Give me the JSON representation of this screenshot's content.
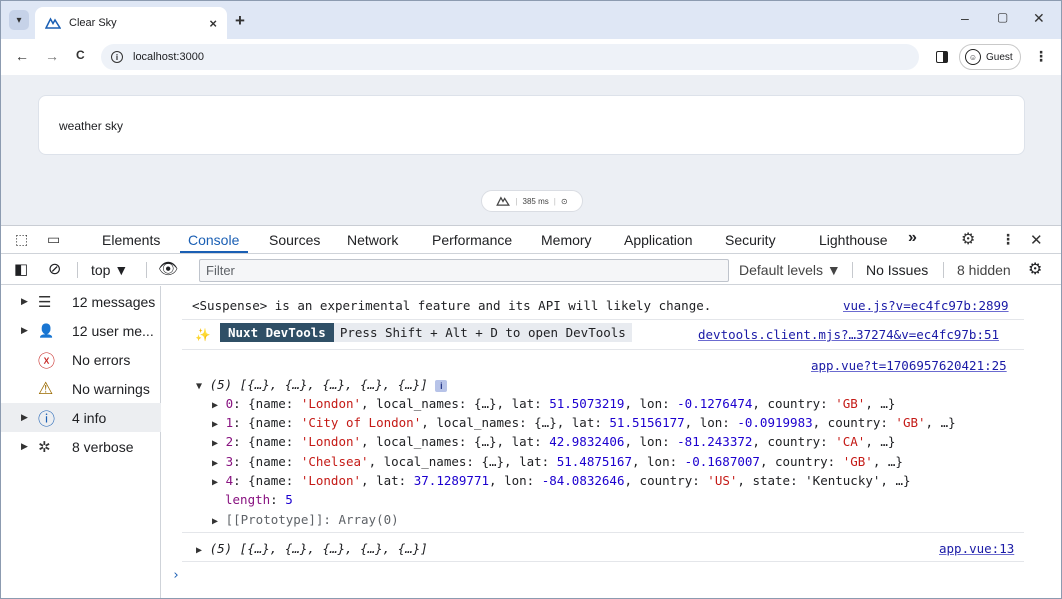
{
  "browser": {
    "tab": {
      "title": "Clear Sky",
      "close": "×"
    },
    "new_tab": "+",
    "window_controls": {
      "minimize": "–",
      "maximize": "▢",
      "close": "✕"
    },
    "nav": {
      "back": "←",
      "forward": "→",
      "reload": "C"
    },
    "url": "localhost:3000",
    "guest_label": "Guest",
    "menu": "⋮"
  },
  "page": {
    "card_text": "weather sky",
    "nuxt_pill": {
      "time": "385 ms"
    }
  },
  "devtools": {
    "tabs": [
      "Elements",
      "Console",
      "Sources",
      "Network",
      "Performance",
      "Memory",
      "Application",
      "Security",
      "Lighthouse"
    ],
    "active_tab": "Console",
    "more_tabs": "»",
    "console_bar": {
      "context": "top ▼",
      "filter_placeholder": "Filter",
      "levels": "Default levels ▼",
      "issues": "No Issues",
      "hidden": "8 hidden"
    },
    "sidebar": [
      {
        "label": "12 messages",
        "icon": "list-icon",
        "glyph": "☰",
        "arrow": "▶"
      },
      {
        "label": "12 user me...",
        "icon": "user-icon",
        "glyph": "👤",
        "arrow": "▶"
      },
      {
        "label": "No errors",
        "icon": "error-icon",
        "glyph": "ⓧ",
        "arrow": ""
      },
      {
        "label": "No warnings",
        "icon": "warning-icon",
        "glyph": "⚠",
        "arrow": ""
      },
      {
        "label": "4 info",
        "icon": "info-icon",
        "glyph": "ⓘ",
        "arrow": "▶"
      },
      {
        "label": "8 verbose",
        "icon": "bug-icon",
        "glyph": "✲",
        "arrow": "▶"
      }
    ],
    "log": {
      "suspense": {
        "text": "<Suspense> is an experimental feature and its API will likely change.",
        "source": "vue.js?v=ec4fc97b:2899"
      },
      "nuxt": {
        "badge": "Nuxt DevTools",
        "message": "Press Shift + Alt + D to open DevTools",
        "source": "devtools.client.mjs?…37274&v=ec4fc97b:51"
      },
      "array_source": "app.vue?t=1706957620421:25",
      "array_header": "(5) [{…}, {…}, {…}, {…}, {…}]",
      "items": [
        {
          "idx": "0",
          "name": "'London'",
          "mid": "local_names: {…}, lat: ",
          "lat": "51.5073219",
          "lon": "-0.1276474",
          "country": "'GB'",
          "tail": ", …}"
        },
        {
          "idx": "1",
          "name": "'City of London'",
          "mid": "local_names: {…}, lat: ",
          "lat": "51.5156177",
          "lon": "-0.0919983",
          "country": "'GB'",
          "tail": ", …}"
        },
        {
          "idx": "2",
          "name": "'London'",
          "mid": "local_names: {…}, lat: ",
          "lat": "42.9832406",
          "lon": "-81.243372",
          "country": "'CA'",
          "tail": ", …}"
        },
        {
          "idx": "3",
          "name": "'Chelsea'",
          "mid": "local_names: {…}, lat: ",
          "lat": "51.4875167",
          "lon": "-0.1687007",
          "country": "'GB'",
          "tail": ", …}"
        },
        {
          "idx": "4",
          "name": "'London'",
          "mid": "lat: ",
          "lat": "37.1289771",
          "lon": "-84.0832646",
          "country": "'US'",
          "tail": ", state: 'Kentucky', …}"
        }
      ],
      "length_label": "length",
      "length_value": "5",
      "prototype": "[[Prototype]]: Array(0)",
      "second_array": "(5) [{…}, {…}, {…}, {…}, {…}]",
      "second_source": "app.vue:13"
    }
  }
}
